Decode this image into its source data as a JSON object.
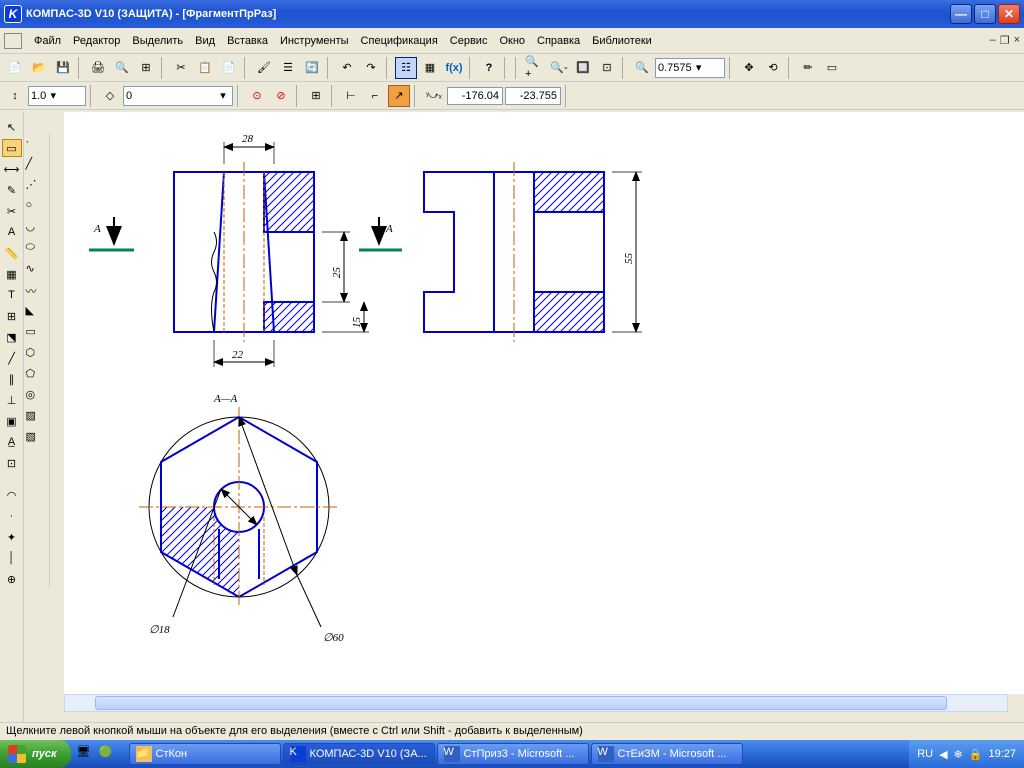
{
  "title": "КОМПАС-3D V10 (ЗАЩИТА) - [ФрагментПрРаз]",
  "menu": [
    "Файл",
    "Редактор",
    "Выделить",
    "Вид",
    "Вставка",
    "Инструменты",
    "Спецификация",
    "Сервис",
    "Окно",
    "Справка",
    "Библиотеки"
  ],
  "zoom": "0.7575",
  "scale": "1.0",
  "layer": "0",
  "coord_x": "-176.04",
  "coord_y": "-23.755",
  "status": "Щелкните левой кнопкой мыши на объекте для его выделения (вместе с Ctrl или Shift - добавить к выделенным)",
  "start": "пуск",
  "tasks": [
    {
      "label": "СтКон",
      "icon": "folder"
    },
    {
      "label": "КОМПАС-3D V10 (ЗА...",
      "icon": "kompas",
      "active": true
    },
    {
      "label": "СтПриз3 - Microsoft ...",
      "icon": "word"
    },
    {
      "label": "СтЕиЗМ - Microsoft ...",
      "icon": "word"
    }
  ],
  "lang": "RU",
  "clock": "19:27",
  "drawing": {
    "section_label": "А—А",
    "arrow_label": "А",
    "d28": "28",
    "d22": "22",
    "d25": "25",
    "d15": "15",
    "d55": "55",
    "dia18": "∅18",
    "dia60": "∅60"
  }
}
